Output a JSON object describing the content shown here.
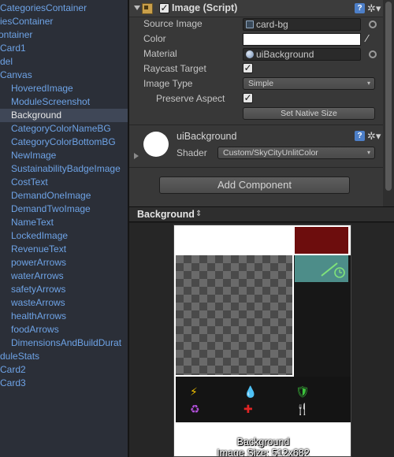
{
  "hierarchy": {
    "items": [
      {
        "label": "CategoriesContainer"
      },
      {
        "label": "iesContainer"
      },
      {
        "label": "ontainer"
      },
      {
        "label": "Card1"
      },
      {
        "label": "del"
      },
      {
        "label": "Canvas"
      },
      {
        "label": "HoveredImage"
      },
      {
        "label": "ModuleScreenshot"
      },
      {
        "label": "Background",
        "selected": true
      },
      {
        "label": "CategoryColorNameBG"
      },
      {
        "label": "CategoryColorBottomBG"
      },
      {
        "label": "NewImage"
      },
      {
        "label": "SustainabilityBadgeImage"
      },
      {
        "label": "CostText"
      },
      {
        "label": "DemandOneImage"
      },
      {
        "label": "DemandTwoImage"
      },
      {
        "label": "NameText"
      },
      {
        "label": "LockedImage"
      },
      {
        "label": "RevenueText"
      },
      {
        "label": "powerArrows"
      },
      {
        "label": "waterArrows"
      },
      {
        "label": "safetyArrows"
      },
      {
        "label": "wasteArrows"
      },
      {
        "label": "healthArrows"
      },
      {
        "label": "foodArrows"
      },
      {
        "label": "DimensionsAndBuildDurat"
      },
      {
        "label": "duleStats"
      },
      {
        "label": "Card2"
      },
      {
        "label": "Card3"
      }
    ]
  },
  "inspector": {
    "image_component": {
      "title": "Image (Script)",
      "enabled": true,
      "source_image_label": "Source Image",
      "source_image_value": "card-bg",
      "color_label": "Color",
      "color_value": "#ffffff",
      "material_label": "Material",
      "material_value": "uiBackground",
      "raycast_label": "Raycast Target",
      "raycast_checked": true,
      "image_type_label": "Image Type",
      "image_type_value": "Simple",
      "preserve_aspect_label": "Preserve Aspect",
      "preserve_aspect_checked": true,
      "set_native_size_label": "Set Native Size"
    },
    "material": {
      "name": "uiBackground",
      "shader_label": "Shader",
      "shader_value": "Custom/SkyCityUnlitColor"
    },
    "add_component_label": "Add Component",
    "check_glyph": "✓",
    "help_glyph": "?",
    "gear_glyph": "✲▾"
  },
  "preview": {
    "header_title": "Background",
    "header_arrow": "⇕",
    "caption_line1": "Background",
    "caption_line2": "Image Size: 512x682",
    "icons": {
      "power": {
        "glyph": "⚡",
        "color": "#f2c200"
      },
      "water": {
        "glyph": "💧",
        "color": "#2f8fe0"
      },
      "safety": {
        "glyph": "🛡",
        "color": "#3cc23c"
      },
      "waste": {
        "glyph": "♻",
        "color": "#b04fd8"
      },
      "health": {
        "glyph": "✚",
        "color": "#e02424"
      },
      "food": {
        "glyph": "🍴",
        "color": "#e07a1e"
      }
    }
  },
  "colors": {
    "hierarchy_text": "#6ea3e6",
    "selected_bg": "#3f4757",
    "red_panel": "#6d0d0d",
    "teal_panel": "#4d8d89"
  }
}
